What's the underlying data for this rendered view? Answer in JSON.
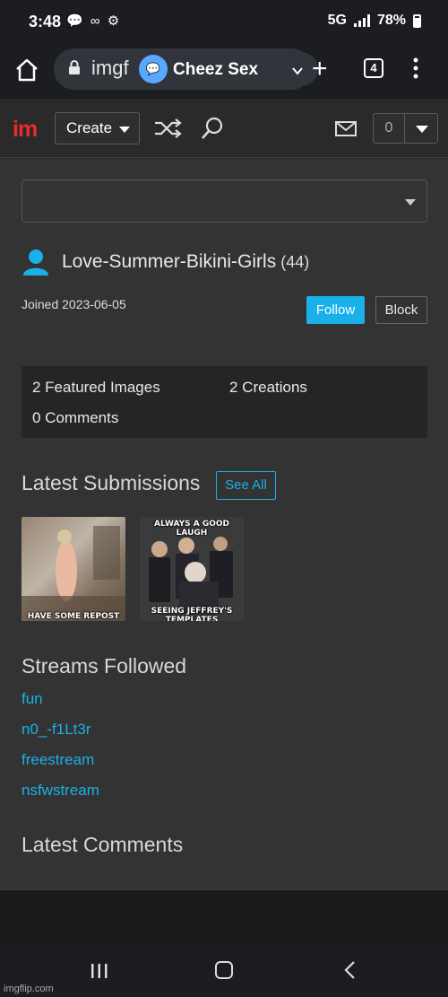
{
  "status_bar": {
    "time": "3:48",
    "left_icons": "💬 ∞ ⚙",
    "network": "5G",
    "battery": "78%"
  },
  "browser": {
    "url_partial": "imgf",
    "bubble_text": "Cheez Sex",
    "tab_count": "4"
  },
  "site_nav": {
    "logo": "im",
    "create_label": "Create",
    "notification_count": "0"
  },
  "profile": {
    "username": "Love-Summer-Bikini-Girls",
    "points": "(44)",
    "joined": "Joined 2023-06-05",
    "follow_label": "Follow",
    "block_label": "Block"
  },
  "stats": {
    "featured": "2 Featured Images",
    "creations": "2 Creations",
    "comments": "0 Comments"
  },
  "submissions": {
    "heading": "Latest Submissions",
    "see_all": "See All",
    "items": [
      {
        "caption": "HAVE SOME REPOST"
      },
      {
        "caption_top": "ALWAYS A GOOD LAUGH",
        "caption_bottom": "SEEING JEFFREY'S TEMPLATES"
      }
    ]
  },
  "streams": {
    "heading": "Streams Followed",
    "items": [
      "fun",
      "n0_-f1Lt3r",
      "freestream",
      "nsfwstream"
    ]
  },
  "comments": {
    "heading": "Latest Comments"
  },
  "watermark": "imgflip.com",
  "colors": {
    "accent": "#1ab0ea",
    "logo_red": "#ea2b2b",
    "background": "#333333"
  }
}
